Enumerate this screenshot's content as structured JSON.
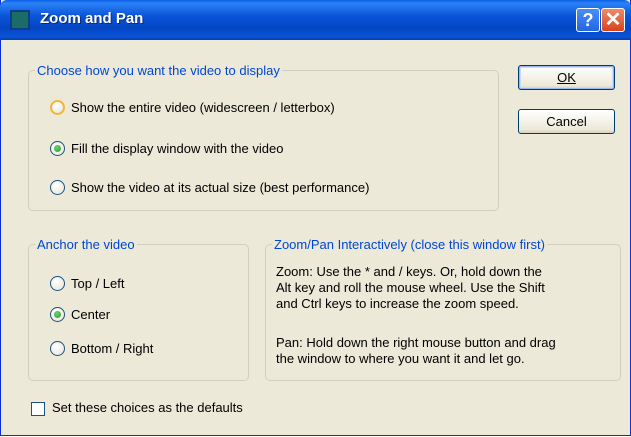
{
  "window": {
    "title": "Zoom and Pan"
  },
  "titlebar": {
    "help_glyph": "?",
    "close_glyph": "✕"
  },
  "display_group": {
    "legend": "Choose how you want the video to display",
    "options": [
      {
        "label": "Show the entire video (widescreen / letterbox)",
        "checked": false
      },
      {
        "label": "Fill the display window with the video",
        "checked": true
      },
      {
        "label": "Show the video at its actual size (best performance)",
        "checked": false
      }
    ]
  },
  "anchor_group": {
    "legend": "Anchor the video",
    "options": [
      {
        "label": "Top / Left",
        "checked": false
      },
      {
        "label": "Center",
        "checked": true
      },
      {
        "label": "Bottom / Right",
        "checked": false
      }
    ]
  },
  "zoom_group": {
    "legend": "Zoom/Pan Interactively (close this window first)",
    "zoom_lines": [
      "Zoom: Use the * and / keys.  Or, hold down the",
      "Alt key and roll the mouse wheel.  Use the Shift",
      "and Ctrl keys to increase the zoom speed."
    ],
    "pan_lines": [
      "Pan: Hold down the right mouse button and drag",
      "the window to where you want it and let go."
    ]
  },
  "buttons": {
    "ok": "OK",
    "cancel": "Cancel"
  },
  "defaults_checkbox": {
    "label": "Set these choices as the defaults",
    "checked": false
  }
}
